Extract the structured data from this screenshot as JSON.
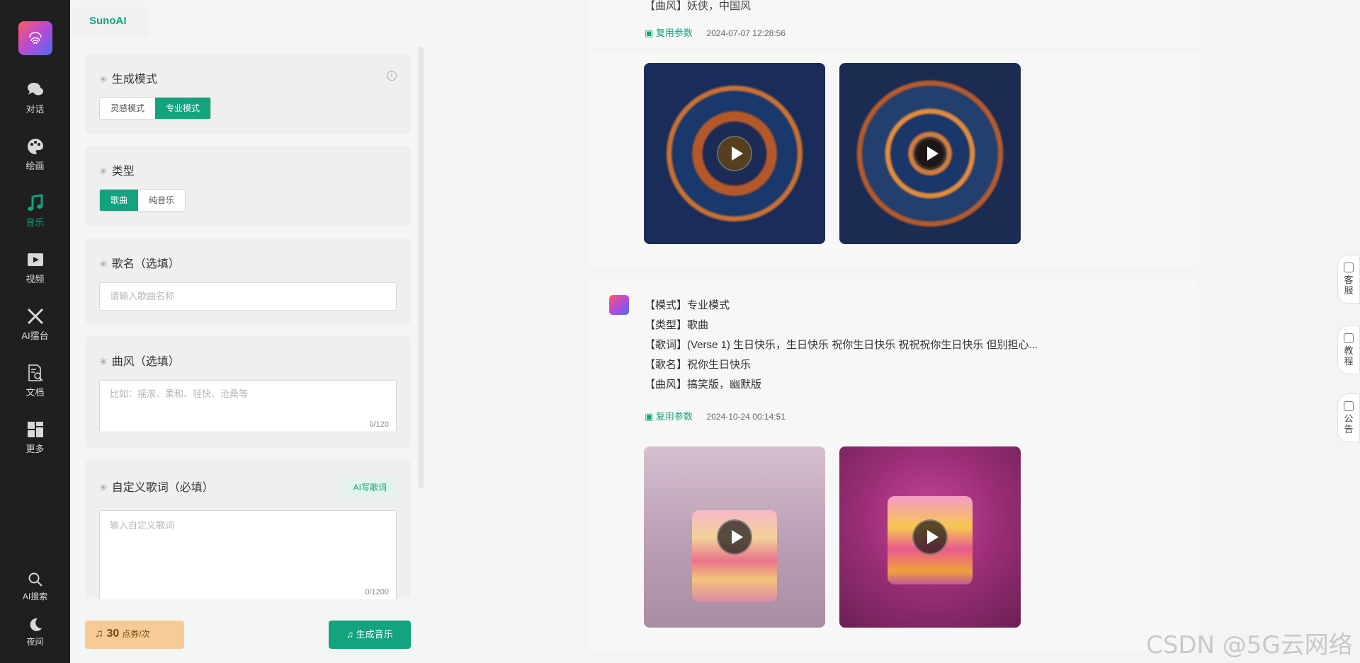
{
  "nav": {
    "items": [
      {
        "label": "对话",
        "icon": "chat-icon"
      },
      {
        "label": "绘画",
        "icon": "palette-icon"
      },
      {
        "label": "音乐",
        "icon": "music-note-icon"
      },
      {
        "label": "视频",
        "icon": "video-icon"
      },
      {
        "label": "AI擂台",
        "icon": "crossed-swords-icon"
      },
      {
        "label": "文档",
        "icon": "document-search-icon"
      },
      {
        "label": "更多",
        "icon": "grid-icon"
      }
    ],
    "bottom": [
      {
        "label": "AI搜索",
        "icon": "search-icon"
      },
      {
        "label": "夜间",
        "icon": "moon-icon"
      }
    ],
    "active_color": "#13a37f"
  },
  "panel": {
    "tab": "SunoAI",
    "mode": {
      "title": "生成模式",
      "options": [
        "灵感模式",
        "专业模式"
      ],
      "selected": "专业模式"
    },
    "type": {
      "title": "类型",
      "options": [
        "歌曲",
        "纯音乐"
      ],
      "selected": "歌曲"
    },
    "name": {
      "title": "歌名（选填）",
      "placeholder": "请输入歌曲名称"
    },
    "style": {
      "title": "曲风（选填）",
      "placeholder": "比如：摇滚、柔和、轻快、沧桑等",
      "counter": "0/120"
    },
    "lyrics": {
      "title": "自定义歌词（必填）",
      "ai_button": "AI写歌词",
      "placeholder": "输入自定义歌词",
      "counter": "0/1200"
    },
    "cost": {
      "value": "30",
      "unit": "点券/次"
    },
    "generate": "生成音乐"
  },
  "feed": {
    "first": {
      "partial_line": "【曲风】妖侠，中国风",
      "reuse": "复用参数",
      "time": "2024-07-07 12:28:56"
    },
    "second": {
      "lines": [
        "【模式】专业模式",
        "【类型】歌曲",
        "【歌词】(Verse 1) 生日快乐，生日快乐 祝你生日快乐 祝祝祝你生日快乐 但别担心...",
        "【歌名】祝你生日快乐",
        "【曲风】搞笑版，幽默版"
      ],
      "reuse": "复用参数",
      "time": "2024-10-24 00:14:51"
    }
  },
  "side": {
    "service": "客服",
    "tutorial": "教程",
    "notice": "公告"
  },
  "watermark": "CSDN @5G云网络"
}
